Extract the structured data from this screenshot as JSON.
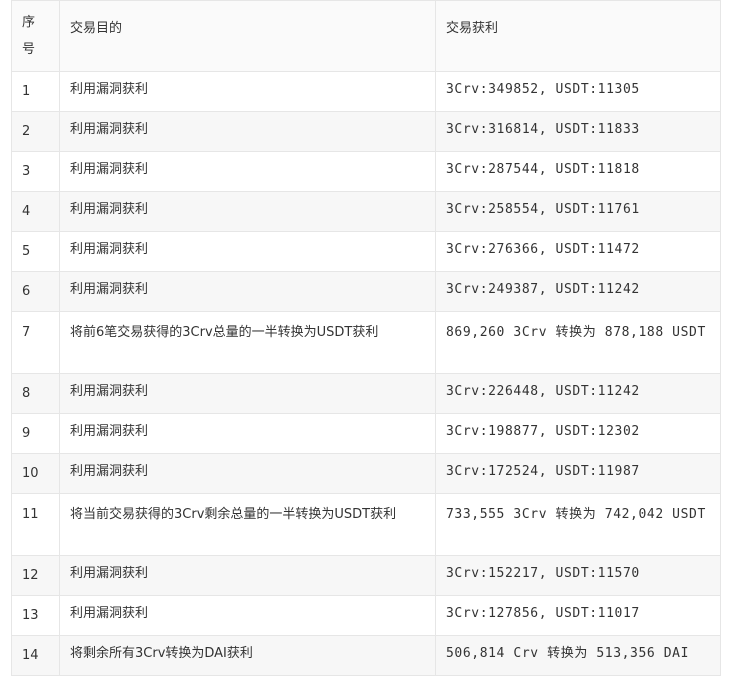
{
  "table": {
    "headers": [
      "序号",
      "交易目的",
      "交易获利"
    ],
    "rows": [
      {
        "no": "1",
        "purpose": "利用漏洞获利",
        "profit": "3Crv:349852, USDT:11305"
      },
      {
        "no": "2",
        "purpose": "利用漏洞获利",
        "profit": "3Crv:316814, USDT:11833"
      },
      {
        "no": "3",
        "purpose": "利用漏洞获利",
        "profit": "3Crv:287544, USDT:11818"
      },
      {
        "no": "4",
        "purpose": "利用漏洞获利",
        "profit": "3Crv:258554, USDT:11761"
      },
      {
        "no": "5",
        "purpose": "利用漏洞获利",
        "profit": "3Crv:276366, USDT:11472"
      },
      {
        "no": "6",
        "purpose": "利用漏洞获利",
        "profit": "3Crv:249387, USDT:11242"
      },
      {
        "no": "7",
        "purpose": "将前6笔交易获得的3Crv总量的一半转换为USDT获利",
        "profit": "869,260 3Crv 转换为 878,188 USDT"
      },
      {
        "no": "8",
        "purpose": "利用漏洞获利",
        "profit": "3Crv:226448, USDT:11242"
      },
      {
        "no": "9",
        "purpose": "利用漏洞获利",
        "profit": "3Crv:198877, USDT:12302"
      },
      {
        "no": "10",
        "purpose": "利用漏洞获利",
        "profit": "3Crv:172524, USDT:11987"
      },
      {
        "no": "11",
        "purpose": "将当前交易获得的3Crv剩余总量的一半转换为USDT获利",
        "profit": "733,555 3Crv 转换为 742,042 USDT"
      },
      {
        "no": "12",
        "purpose": "利用漏洞获利",
        "profit": "3Crv:152217, USDT:11570"
      },
      {
        "no": "13",
        "purpose": "利用漏洞获利",
        "profit": "3Crv:127856, USDT:11017"
      },
      {
        "no": "14",
        "purpose": "将剩余所有3Crv转换为DAI获利",
        "profit": "506,814 Crv 转换为 513,356 DAI"
      }
    ]
  }
}
